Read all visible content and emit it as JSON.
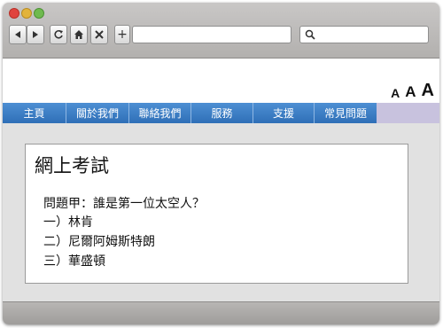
{
  "browser": {
    "address": "",
    "search_value": "",
    "new_tab_label": "+"
  },
  "font_sizes": [
    "A",
    "A",
    "A"
  ],
  "menu": [
    {
      "label": "主頁"
    },
    {
      "label": "關於我們"
    },
    {
      "label": "聯絡我們"
    },
    {
      "label": "服務"
    },
    {
      "label": "支援"
    },
    {
      "label": "常見問題"
    }
  ],
  "exam": {
    "title": "網上考試",
    "question": "問題甲：誰是第一位太空人？",
    "options": [
      "一）林肯",
      "二）尼爾阿姆斯特朗",
      "三）華盛頓"
    ]
  },
  "colors": {
    "menu_blue": "#2f6fb7",
    "menu_fill": "#c8c2de"
  }
}
